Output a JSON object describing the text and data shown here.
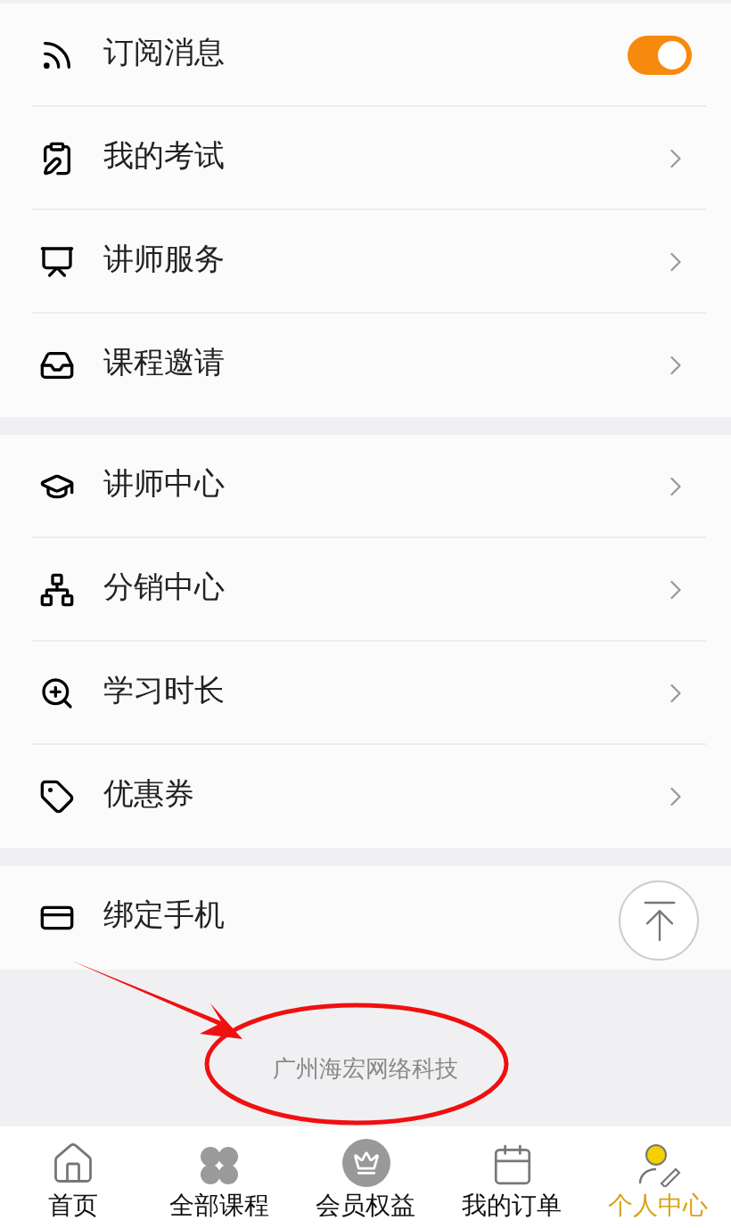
{
  "sections": [
    {
      "items": [
        {
          "kind": "toggle",
          "label": "订阅消息",
          "on": true
        },
        {
          "kind": "link",
          "label": "我的考试"
        },
        {
          "kind": "link",
          "label": "讲师服务"
        },
        {
          "kind": "link",
          "label": "课程邀请"
        }
      ]
    },
    {
      "items": [
        {
          "kind": "link",
          "label": "讲师中心"
        },
        {
          "kind": "link",
          "label": "分销中心"
        },
        {
          "kind": "link",
          "label": "学习时长"
        },
        {
          "kind": "link",
          "label": "优惠券"
        }
      ]
    },
    {
      "items": [
        {
          "kind": "plain",
          "label": "绑定手机"
        }
      ]
    }
  ],
  "footer": {
    "text": "广州海宏网络科技"
  },
  "tabs": [
    {
      "label": "首页",
      "selected": false
    },
    {
      "label": "全部课程",
      "selected": false
    },
    {
      "label": "会员权益",
      "selected": false
    },
    {
      "label": "我的订单",
      "selected": false
    },
    {
      "label": "个人中心",
      "selected": true
    }
  ]
}
